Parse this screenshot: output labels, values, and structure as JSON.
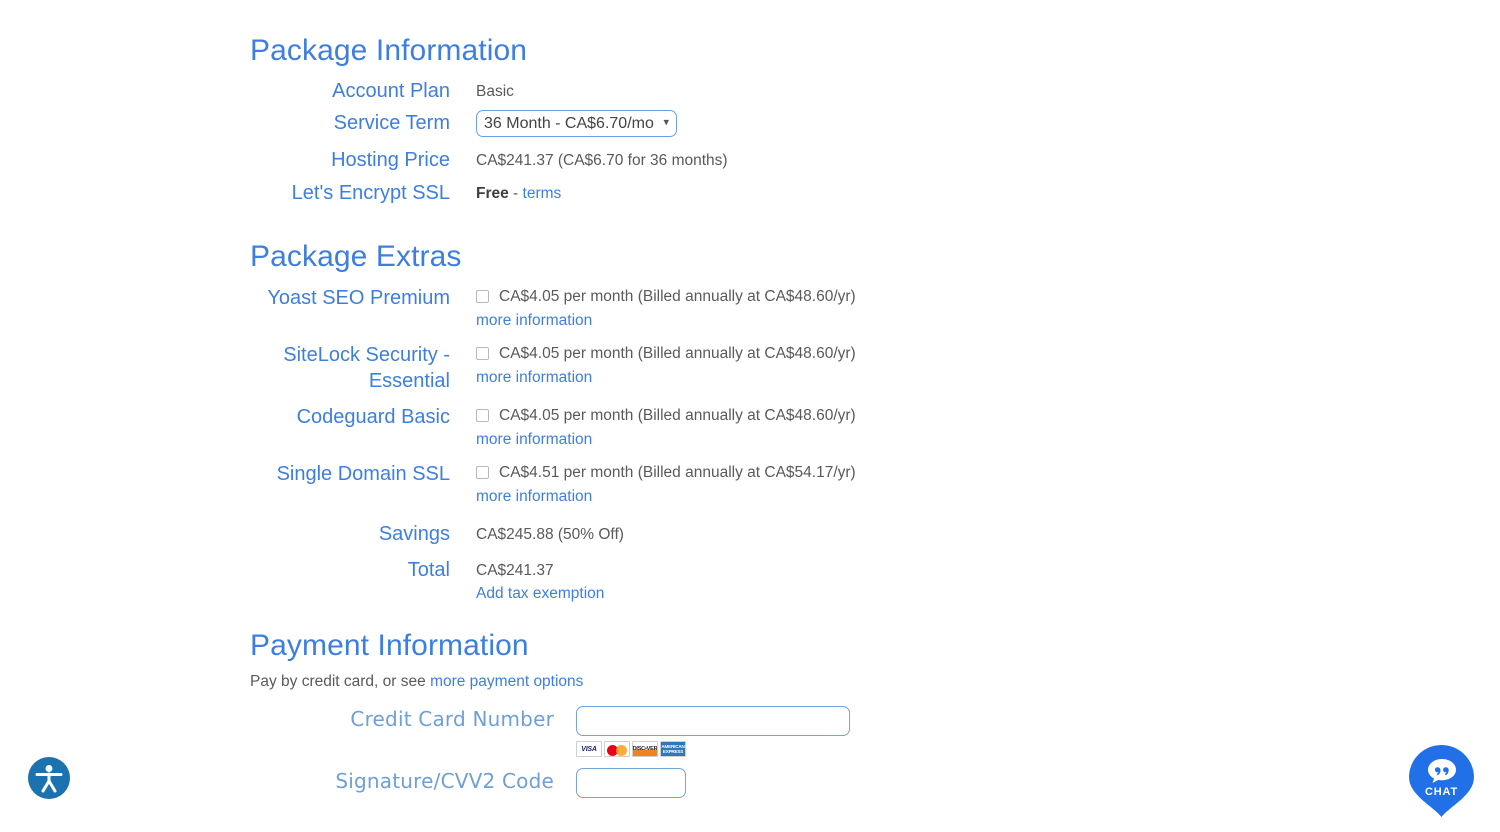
{
  "package_information": {
    "title": "Package Information",
    "rows": [
      {
        "label": "Account Plan",
        "value": "Basic"
      },
      {
        "label": "Service Term",
        "value": "36 Month - CA$6.70/mo"
      },
      {
        "label": "Hosting Price",
        "value": "CA$241.37 (CA$6.70 for 36 months)"
      },
      {
        "label": "Let's Encrypt SSL",
        "value": "Free",
        "link": "terms",
        "separator": "-"
      }
    ],
    "service_term_options": [
      "36 Month - CA$6.70/mo"
    ]
  },
  "package_extras": {
    "title": "Package Extras",
    "items": [
      {
        "label": "Yoast SEO Premium",
        "price_text": "CA$4.05 per month (Billed annually at CA$48.60/yr)",
        "more_info": "more information",
        "checked": false
      },
      {
        "label": "SiteLock Security - Essential",
        "price_text": "CA$4.05 per month (Billed annually at CA$48.60/yr)",
        "more_info": "more information",
        "checked": false
      },
      {
        "label": "Codeguard Basic",
        "price_text": "CA$4.05 per month (Billed annually at CA$48.60/yr)",
        "more_info": "more information",
        "checked": false
      },
      {
        "label": "Single Domain SSL",
        "price_text": "CA$4.51 per month (Billed annually at CA$54.17/yr)",
        "more_info": "more information",
        "checked": false
      }
    ],
    "savings": {
      "label": "Savings",
      "value": "CA$245.88 (50% Off)"
    },
    "total": {
      "label": "Total",
      "value": "CA$241.37",
      "link": "Add tax exemption"
    }
  },
  "payment_information": {
    "title": "Payment Information",
    "subtitle_prefix": "Pay by credit card, or see ",
    "subtitle_link": "more payment options",
    "credit_card": {
      "label": "Credit Card Number",
      "value": "",
      "placeholder": ""
    },
    "cvv": {
      "label": "Signature/CVV2 Code",
      "value": "",
      "placeholder": ""
    },
    "accepted_cards": [
      "VISA",
      "MasterCard",
      "DISCOVER",
      "AMERICAN EXPRESS"
    ]
  },
  "widgets": {
    "accessibility": {
      "icon": "accessibility-icon",
      "color": "#1b72ae"
    },
    "chat": {
      "label": "CHAT",
      "icon": "chat-bubble-icon",
      "color": "#2170e8"
    }
  },
  "colors": {
    "heading_blue": "#3d7fe0",
    "label_blue": "#3d7fe0",
    "payment_label_blue": "#6e9fd8",
    "body_gray": "#5a5a5a",
    "input_border": "#74a3dd"
  }
}
